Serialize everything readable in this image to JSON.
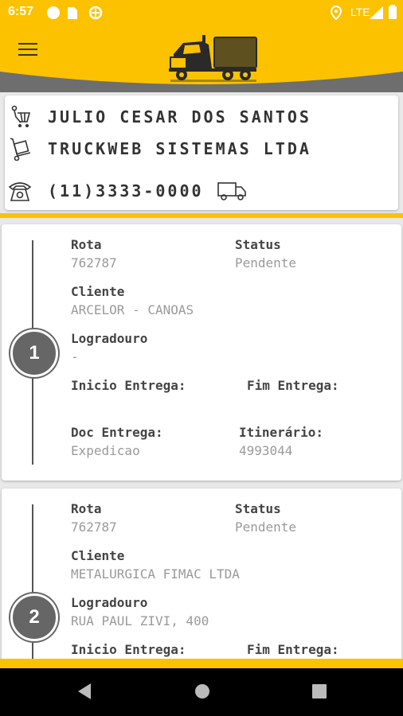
{
  "status_bar": {
    "time": "6:57",
    "network": "LTE"
  },
  "driver": {
    "name": "JULIO CESAR DOS  SANTOS",
    "company": "TRUCKWEB SISTEMAS LTDA",
    "phone": "(11)3333-0000"
  },
  "deliveries": [
    {
      "number": "1",
      "rota_label": "Rota",
      "rota": "762787",
      "status_label": "Status",
      "status": "Pendente",
      "cliente_label": "Cliente",
      "cliente": "ARCELOR - CANOAS",
      "logradouro_label": "Logradouro",
      "logradouro": "-",
      "inicio_label": "Inicio Entrega:",
      "fim_label": "Fim Entrega:",
      "doc_label": "Doc Entrega:",
      "doc": "Expedicao",
      "itinerario_label": "Itinerário:",
      "itinerario": "4993044"
    },
    {
      "number": "2",
      "rota_label": "Rota",
      "rota": "762787",
      "status_label": "Status",
      "status": "Pendente",
      "cliente_label": "Cliente",
      "cliente": "METALURGICA FIMAC LTDA",
      "logradouro_label": "Logradouro",
      "logradouro": "RUA PAUL ZIVI, 400",
      "inicio_label": "Inicio Entrega:",
      "fim_label": "Fim Entrega:"
    }
  ],
  "colors": {
    "accent": "#fcc200",
    "curve": "#6e6e6e",
    "badge": "#666666"
  },
  "icons": [
    "menu-icon",
    "truck-logo-icon",
    "cart-icon",
    "dolly-icon",
    "telephone-icon",
    "delivery-truck-icon",
    "back-icon",
    "home-icon",
    "recents-icon"
  ]
}
